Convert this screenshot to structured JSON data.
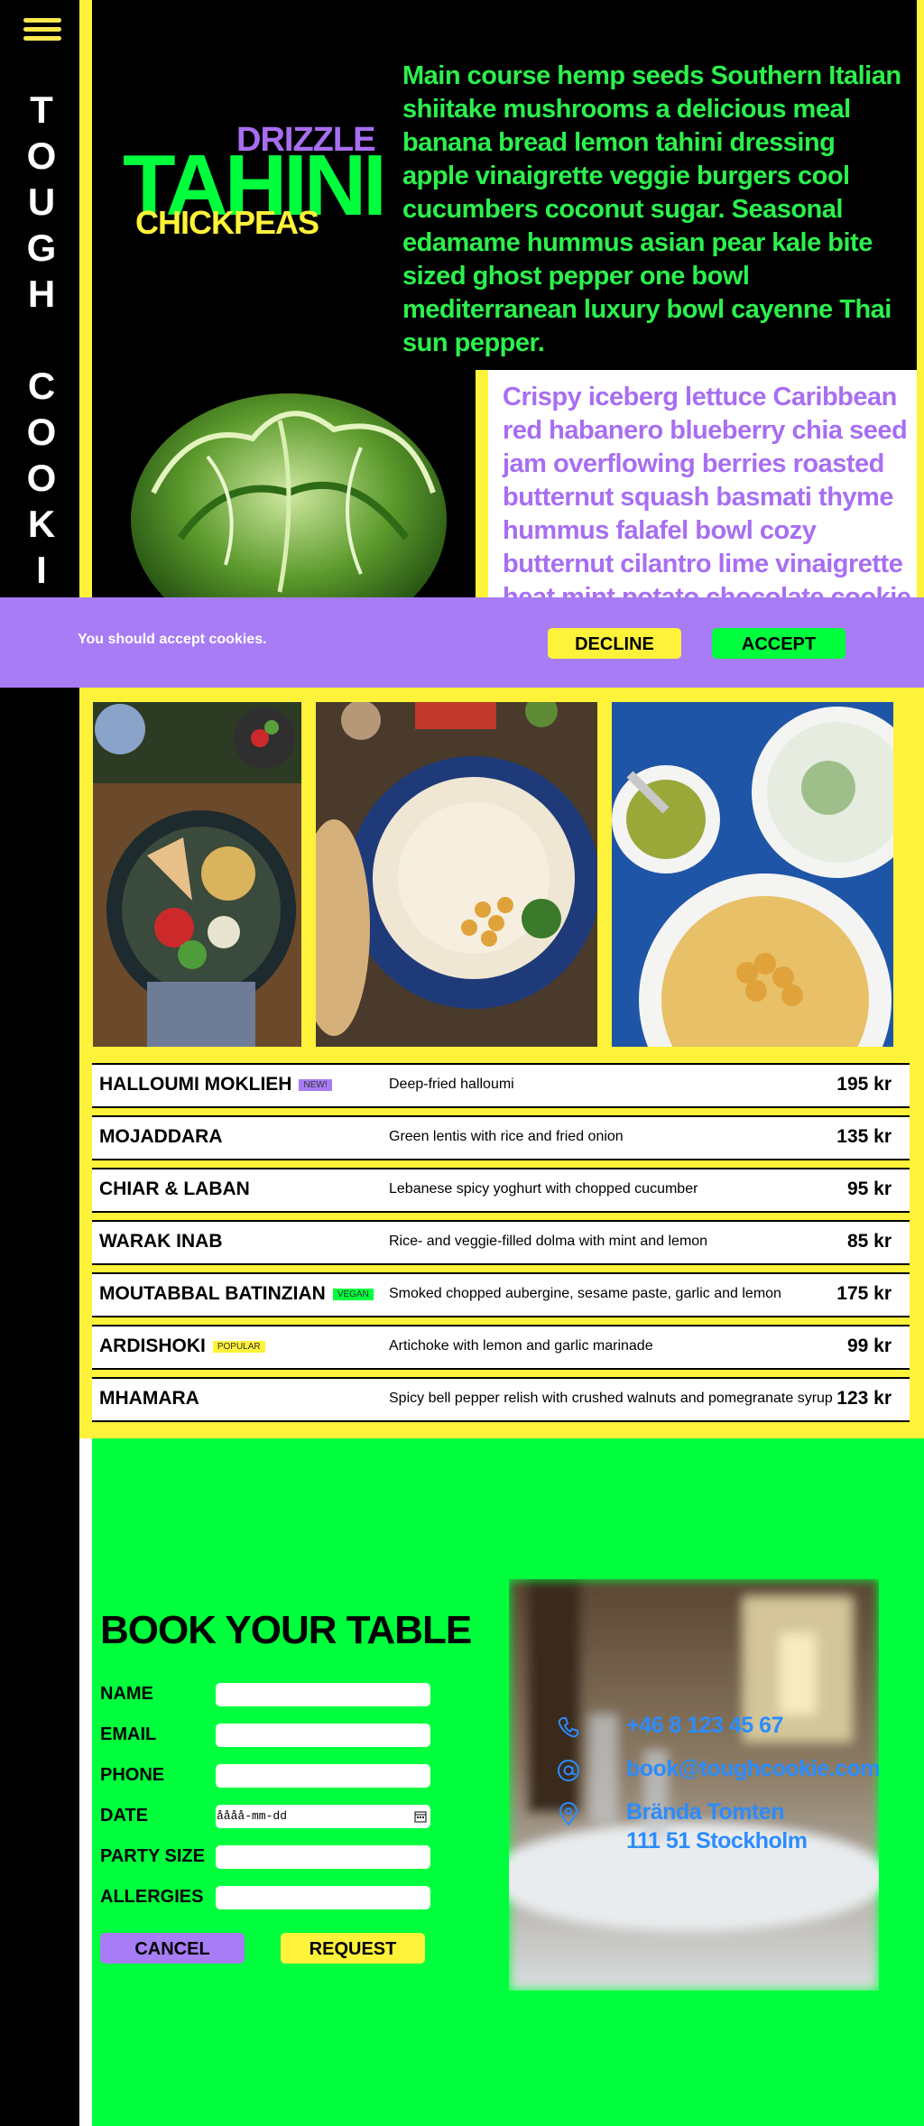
{
  "brand": {
    "vertical_title": "TOUGH COOKIE",
    "logo": {
      "top": "DRIZZLE",
      "main": "TAHINI",
      "bottom": "CHICKPEAS"
    }
  },
  "hero": {
    "intro": "Main course hemp seeds Southern Italian shiitake mushrooms a delicious meal banana bread lemon tahini dressing apple vinaigrette veggie burgers cool cucumbers coconut sugar. Seasonal edamame hummus asian pear kale bite sized ghost pepper one bowl mediterranean luxury bowl cayenne Thai sun pepper.",
    "side_text": "Crispy iceberg lettuce Caribbean red habanero blueberry chia seed jam overflowing berries roasted butternut squash basmati thyme hummus falafel bowl cozy butternut cilantro lime vinaigrette heat mint potato chocolate cookie seeds samosa walnut"
  },
  "cookie_banner": {
    "message": "You should accept cookies.",
    "decline_label": "DECLINE",
    "accept_label": "ACCEPT"
  },
  "menu": [
    {
      "name": "HALLOUMI MOKLIEH",
      "badge": "NEW!",
      "badge_color": "#a77cf5",
      "description": "Deep-fried halloumi",
      "price": "195 kr"
    },
    {
      "name": "MOJADDARA",
      "badge": "",
      "badge_color": "",
      "description": "Green lentis with rice and fried onion",
      "price": "135 kr"
    },
    {
      "name": "CHIAR & LABAN",
      "badge": "",
      "badge_color": "",
      "description": "Lebanese spicy yoghurt with chopped cucumber",
      "price": "95 kr"
    },
    {
      "name": "WARAK INAB",
      "badge": "",
      "badge_color": "",
      "description": "Rice- and veggie-filled dolma with mint and lemon",
      "price": "85 kr"
    },
    {
      "name": "MOUTABBAL BATINZIAN",
      "badge": "VEGAN",
      "badge_color": "#00ff3c",
      "description": "Smoked chopped aubergine, sesame paste, garlic and lemon",
      "price": "175 kr"
    },
    {
      "name": "ARDISHOKI",
      "badge": "POPULAR",
      "badge_color": "#fff23a",
      "description": "Artichoke with lemon and garlic marinade",
      "price": "99 kr"
    },
    {
      "name": "MHAMARA",
      "badge": "",
      "badge_color": "",
      "description": "Spicy bell pepper relish with crushed walnuts and pomegranate syrup",
      "price": "123 kr"
    }
  ],
  "booking": {
    "title": "BOOK YOUR TABLE",
    "fields": {
      "name": "NAME",
      "email": "EMAIL",
      "phone": "PHONE",
      "date": "DATE",
      "party_size": "PARTY SIZE",
      "allergies": "ALLERGIES"
    },
    "date_placeholder": "åååå-mm-dd",
    "cancel_label": "CANCEL",
    "request_label": "REQUEST"
  },
  "contact": {
    "phone": "+46 8 123 45 67",
    "email": "book@toughcookie.com",
    "address_line1": "Brända Tomten",
    "address_line2": "111 51 Stockholm"
  },
  "colors": {
    "yellow": "#fff23a",
    "green": "#00ff3c",
    "purple": "#a77cf5",
    "black": "#000000",
    "contact_blue": "#2b8cff"
  },
  "icons": [
    "menu-icon",
    "phone-icon",
    "at-icon",
    "location-icon",
    "calendar-icon"
  ]
}
